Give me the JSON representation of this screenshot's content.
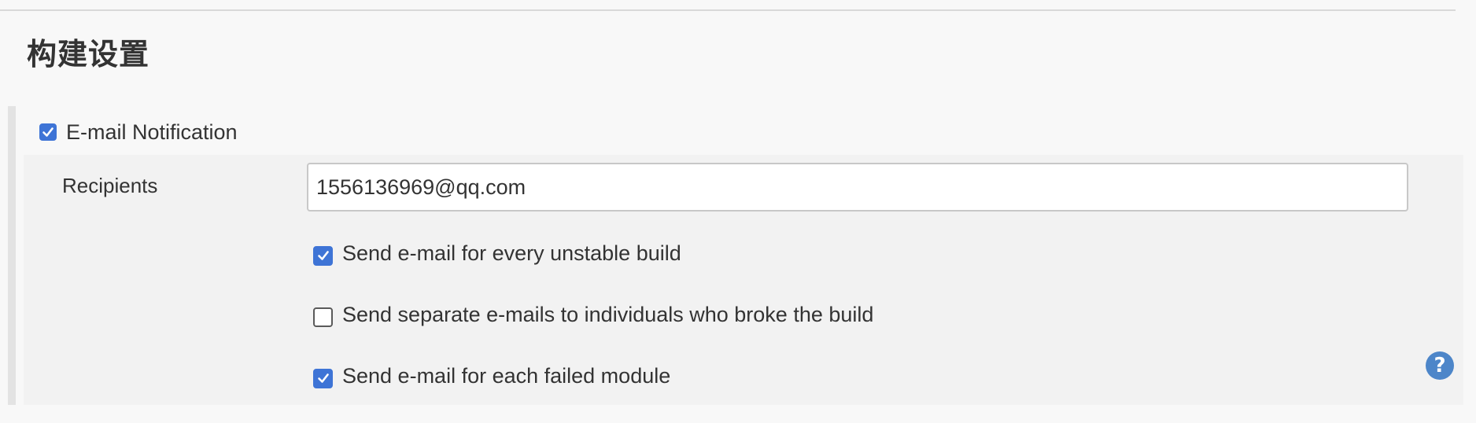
{
  "section": {
    "title": "构建设置"
  },
  "email_notification": {
    "label": "E-mail Notification",
    "checked": true,
    "recipients_label": "Recipients",
    "recipients_value": "1556136969@qq.com",
    "options": [
      {
        "label": "Send e-mail for every unstable build",
        "checked": true
      },
      {
        "label": "Send separate e-mails to individuals who broke the build",
        "checked": false
      },
      {
        "label": "Send e-mail for each failed module",
        "checked": true
      }
    ],
    "help_icon": "question-mark-icon"
  },
  "colors": {
    "accent": "#3e74d6",
    "help": "#4d86c9",
    "panel": "#f2f2f2",
    "background": "#f8f8f8"
  }
}
